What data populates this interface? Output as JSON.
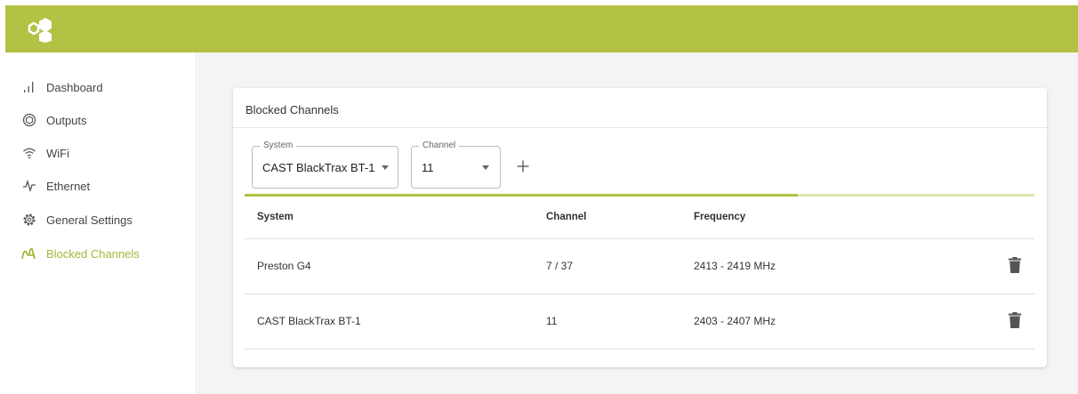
{
  "header": {
    "logo_icon": "hexagon-logo-icon",
    "brand_color": "#b3c144"
  },
  "sidebar": {
    "items": [
      {
        "label": "Dashboard",
        "icon": "bar-chart-icon"
      },
      {
        "label": "Outputs",
        "icon": "aperture-icon"
      },
      {
        "label": "WiFi",
        "icon": "wifi-icon"
      },
      {
        "label": "Ethernet",
        "icon": "pulse-icon"
      },
      {
        "label": "General Settings",
        "icon": "gear-icon"
      },
      {
        "label": "Blocked Channels",
        "icon": "blocked-channels-icon",
        "active": true
      }
    ]
  },
  "card": {
    "title": "Blocked Channels",
    "system_field": {
      "legend": "System",
      "value": "CAST BlackTrax BT-1"
    },
    "channel_field": {
      "legend": "Channel",
      "value": "11"
    },
    "add_icon": "plus-icon",
    "progress": 0.7
  },
  "table": {
    "headers": [
      "System",
      "Channel",
      "Frequency"
    ],
    "rows": [
      {
        "system": "Preston G4",
        "channel": "7 / 37",
        "frequency": "2413 - 2419 MHz"
      },
      {
        "system": "CAST BlackTrax BT-1",
        "channel": "11",
        "frequency": "2403 - 2407 MHz"
      }
    ],
    "delete_icon": "trash-icon"
  }
}
